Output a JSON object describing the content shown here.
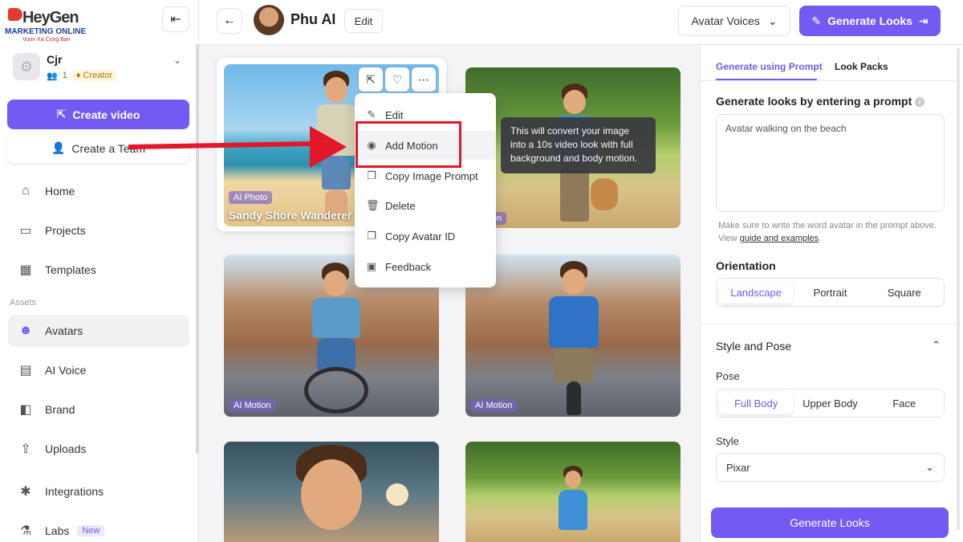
{
  "logo": {
    "brand": "HeyGen",
    "tagline1": "MARKETING ONLINE",
    "tagline2": "Vuon Xa Cung Ban"
  },
  "account": {
    "name": "Cjr",
    "members": "1",
    "plan": "Creator"
  },
  "sidebar": {
    "create_video": "Create video",
    "create_team": "Create a Team",
    "assets_label": "Assets",
    "items": [
      {
        "label": "Home",
        "icon": "home-icon"
      },
      {
        "label": "Projects",
        "icon": "folder-icon"
      },
      {
        "label": "Templates",
        "icon": "templates-icon"
      },
      {
        "label": "Avatars",
        "icon": "avatar-icon"
      },
      {
        "label": "AI Voice",
        "icon": "ai-voice-icon"
      },
      {
        "label": "Brand",
        "icon": "brand-icon"
      },
      {
        "label": "Uploads",
        "icon": "upload-icon"
      },
      {
        "label": "Integrations",
        "icon": "integrations-icon"
      },
      {
        "label": "Labs",
        "icon": "labs-icon",
        "badge": "New"
      }
    ]
  },
  "header": {
    "title": "Phu AI",
    "edit_label": "Edit",
    "voices_label": "Avatar Voices",
    "generate_label": "Generate Looks"
  },
  "grid": {
    "cards": [
      {
        "tag": "AI Photo",
        "title": "Sandy Shore Wanderer 2"
      },
      {
        "tag": "Motion",
        "title": ""
      },
      {
        "tag": "AI Motion",
        "title": ""
      },
      {
        "tag": "AI Motion",
        "title": ""
      },
      {
        "tag": "",
        "title": ""
      },
      {
        "tag": "",
        "title": ""
      }
    ]
  },
  "context_menu": {
    "items": [
      "Edit",
      "Add Motion",
      "Copy Image Prompt",
      "Delete",
      "Copy Avatar ID",
      "Feedback"
    ]
  },
  "tooltip": "This will convert your image into a 10s video look with full background and body motion.",
  "panel": {
    "tabs": [
      "Generate using Prompt",
      "Look Packs"
    ],
    "prompt_title": "Generate looks by entering a prompt",
    "prompt_value": "Avatar walking on the beach",
    "help_text": "Make sure to write the word avatar in the prompt above. View ",
    "help_link": "guide and examples",
    "help_end": ".",
    "orientation_title": "Orientation",
    "orientation_options": [
      "Landscape",
      "Portrait",
      "Square"
    ],
    "orientation_selected": "Landscape",
    "style_pose_title": "Style and Pose",
    "pose_label": "Pose",
    "pose_options": [
      "Full Body",
      "Upper Body",
      "Face"
    ],
    "pose_selected": "Full Body",
    "style_label": "Style",
    "style_value": "Pixar",
    "generate_label": "Generate Looks"
  },
  "colors": {
    "accent": "#7559f3",
    "annotation_red": "#e3172a",
    "tooltip_bg": "#3a3a3f"
  }
}
